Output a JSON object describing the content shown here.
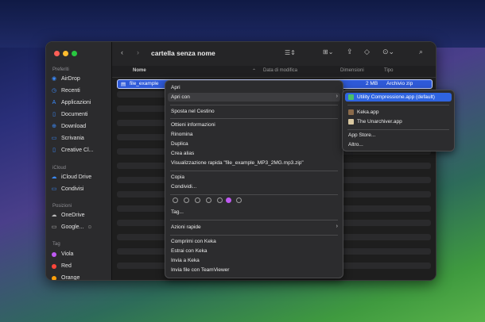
{
  "window": {
    "title": "cartella senza nome",
    "traffic_colors": [
      "#ff5f57",
      "#febc2e",
      "#28c840"
    ]
  },
  "sidebar": {
    "sections": {
      "preferiti": "Preferiti",
      "icloud": "iCloud",
      "posizioni": "Posizioni",
      "tag": "Tag"
    },
    "preferiti": [
      {
        "label": "AirDrop",
        "icon": "airdrop-icon"
      },
      {
        "label": "Recenti",
        "icon": "clock-icon"
      },
      {
        "label": "Applicazioni",
        "icon": "apps-icon"
      },
      {
        "label": "Documenti",
        "icon": "document-icon"
      },
      {
        "label": "Download",
        "icon": "download-icon"
      },
      {
        "label": "Scrivania",
        "icon": "desktop-icon"
      },
      {
        "label": "Creative Cl...",
        "icon": "document-icon"
      }
    ],
    "icloud": [
      {
        "label": "iCloud Drive",
        "icon": "cloud-icon"
      },
      {
        "label": "Condivisi",
        "icon": "folder-icon"
      }
    ],
    "posizioni": [
      {
        "label": "OneDrive",
        "icon": "cloud-icon"
      },
      {
        "label": "Google...",
        "icon": "drive-icon"
      }
    ],
    "tags": [
      {
        "label": "Viola",
        "color": "#bf5af2"
      },
      {
        "label": "Red",
        "color": "#ff453a"
      },
      {
        "label": "Orange",
        "color": "#ff9f0a"
      }
    ]
  },
  "columns": {
    "name": "Nome",
    "date": "Data di modifica",
    "size": "Dimensioni",
    "type": "Tipo"
  },
  "selected_file": {
    "name": "file_example",
    "size": "2 MB",
    "type": "Archivio zip"
  },
  "context_menu": {
    "apri": "Apri",
    "apri_con": "Apri con",
    "sposta": "Sposta nel Cestino",
    "ottieni": "Ottieni informazioni",
    "rinomina": "Rinomina",
    "duplica": "Duplica",
    "alias": "Crea alias",
    "visualizzazione": "Visualizzazione rapida \"file_example_MP3_2MG.mp3.zip\"",
    "copia": "Copia",
    "condividi": "Condividi...",
    "tag": "Tag...",
    "azioni": "Azioni rapide",
    "comprimi": "Comprimi con Keka",
    "estrai": "Estrai con Keka",
    "invia": "Invia a Keka",
    "teamviewer": "Invia file con TeamViewer",
    "tag_colors": [
      "#9a9a9a",
      "#9a9a9a",
      "#9a9a9a",
      "#9a9a9a",
      "#9a9a9a",
      "#bf5af2",
      "#9a9a9a"
    ]
  },
  "submenu": {
    "utility": "Utility Compressione.app (default)",
    "keka": "Keka.app",
    "unarchiver": "The Unarchiver.app",
    "store": "App Store...",
    "altro": "Altro..."
  }
}
